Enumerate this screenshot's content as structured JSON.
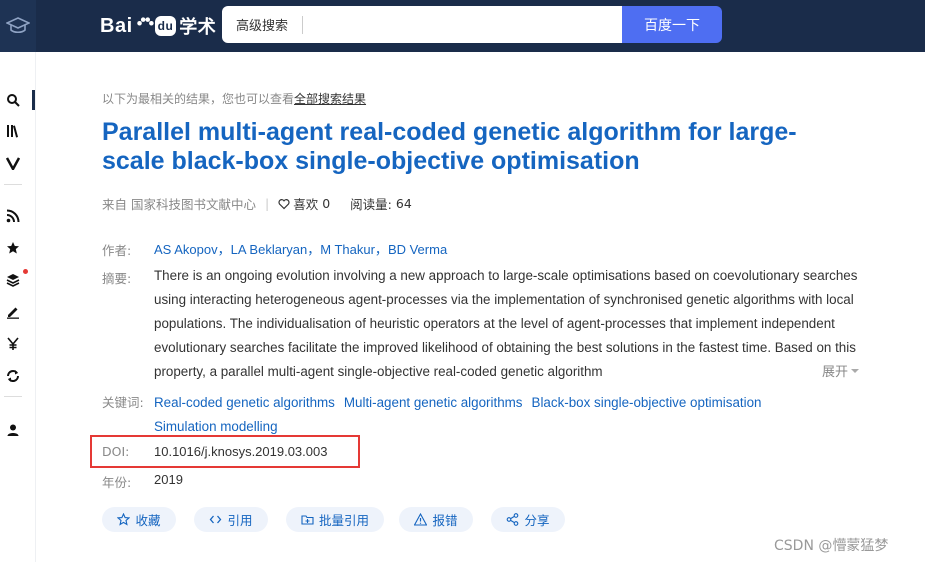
{
  "header": {
    "logo_text_a": "Bai",
    "logo_text_du": "du",
    "logo_text_xueshu": "学术",
    "search_advanced_label": "高级搜索",
    "search_button_label": "百度一下"
  },
  "sidebar": {
    "icons": [
      "search-icon",
      "library-icon",
      "v-icon",
      "rss-icon",
      "star-icon",
      "layers-icon",
      "edit-icon",
      "yen-icon",
      "refresh-icon",
      "user-icon"
    ]
  },
  "result": {
    "hint_prefix": "以下为最相关的结果，您也可以查看",
    "hint_link": "全部搜索结果",
    "title": "Parallel multi-agent real-coded genetic algorithm for large-scale black-box single-objective optimisation",
    "source": "来自 国家科技图书文献中心",
    "likes_label": "喜欢",
    "likes_count": "0",
    "reads_label": "阅读量:",
    "reads_count": "64",
    "authors_label": "作者:",
    "authors": [
      "AS Akopov",
      "LA Beklaryan",
      "M Thakur",
      "BD Verma"
    ],
    "abstract_label": "摘要:",
    "abstract": "There is an ongoing evolution involving a new approach to large-scale optimisations based on coevolutionary searches using interacting heterogeneous agent-processes via the implementation of synchronised genetic algorithms with local populations. The individualisation of heuristic operators at the level of agent-processes that implement independent evolutionary searches facilitate the improved likelihood of obtaining the best solutions in the fastest time. Based on this property, a parallel multi-agent single-objective real-coded genetic algorithm",
    "expand_label": "展开",
    "keywords_label": "关键词:",
    "keywords": [
      "Real-coded genetic algorithms",
      "Multi-agent genetic algorithms",
      "Black-box single-objective optimisation",
      "Simulation modelling"
    ],
    "doi_label": "DOI:",
    "doi": "10.1016/j.knosys.2019.03.003",
    "year_label": "年份:",
    "year": "2019"
  },
  "actions": [
    {
      "label": "收藏",
      "icon": "star-outline-icon"
    },
    {
      "label": "引用",
      "icon": "code-icon"
    },
    {
      "label": "批量引用",
      "icon": "folder-plus-icon"
    },
    {
      "label": "报错",
      "icon": "warning-icon"
    },
    {
      "label": "分享",
      "icon": "share-icon"
    }
  ],
  "watermark": "CSDN @懵蒙猛梦",
  "colors": {
    "header_bg": "#1a2c4a",
    "accent_blue": "#4e6ef2",
    "link_blue": "#1565c0",
    "highlight_red": "#e53935"
  }
}
